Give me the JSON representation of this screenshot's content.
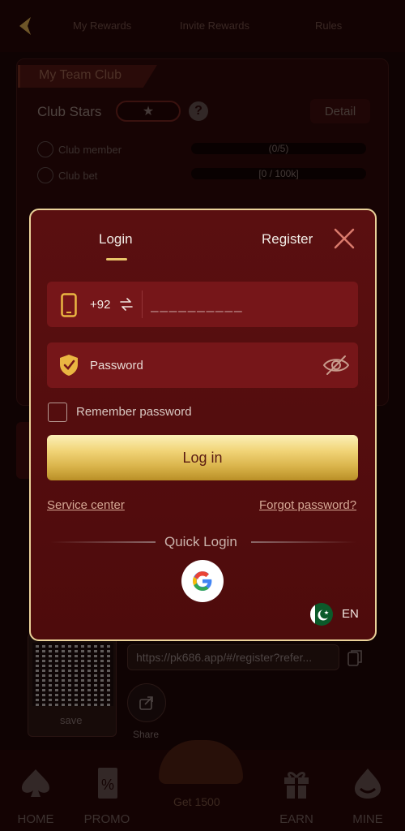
{
  "topnav": {
    "tabs": [
      "My Rewards",
      "Invite Rewards",
      "Rules"
    ]
  },
  "club": {
    "title": "My Team Club",
    "stars_label": "Club Stars",
    "detail_label": "Detail",
    "member_label": "Club member",
    "member_progress": "(0/5)",
    "bet_label": "Club bet",
    "bet_progress": "[0 / 100k]"
  },
  "referral": {
    "save_label": "save",
    "url": "https://pk686.app/#/register?refer...",
    "share_label": "Share"
  },
  "bottom_nav": {
    "home": "HOME",
    "promo": "PROMO",
    "center": "Get 1500",
    "earn": "EARN",
    "mine": "MINE"
  },
  "modal": {
    "tab_login": "Login",
    "tab_register": "Register",
    "country_code": "+92",
    "phone_placeholder": "__________",
    "password_placeholder": "Password",
    "remember_label": "Remember password",
    "login_button": "Log in",
    "service_center": "Service center",
    "forgot_password": "Forgot password?",
    "quick_login_label": "Quick Login",
    "language": "EN"
  },
  "colors": {
    "modal_bg": "#5a0f10",
    "modal_border": "#ebd29a",
    "field_bg": "#761619",
    "accent_gold": "#e9c56a",
    "button_gold": "#f1d477"
  },
  "icons": {
    "back": "back-arrow-icon",
    "close": "close-icon",
    "phone": "phone-icon",
    "swap": "swap-arrows-icon",
    "shield": "shield-check-icon",
    "eye": "eye-slash-icon",
    "google": "google-icon",
    "flag": "pakistan-flag-icon"
  }
}
